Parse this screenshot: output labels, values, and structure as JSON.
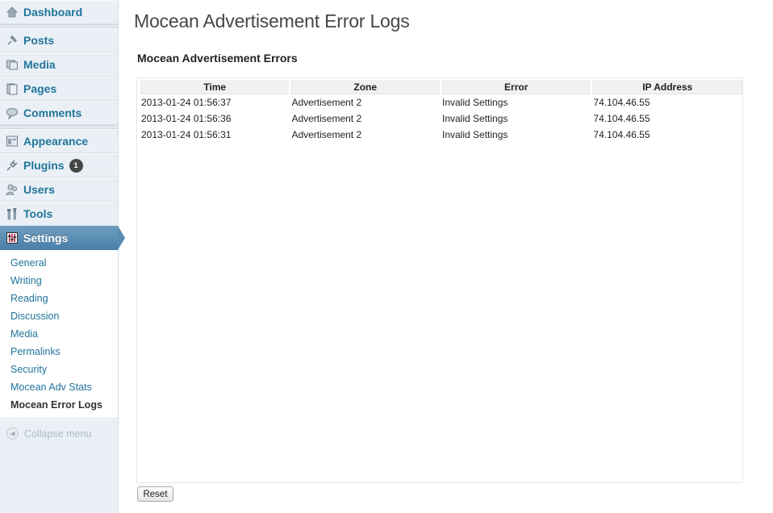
{
  "sidebar": {
    "items": [
      {
        "label": "Dashboard",
        "icon": "dashboard-icon"
      },
      {
        "label": "Posts",
        "icon": "pushpin-icon"
      },
      {
        "label": "Media",
        "icon": "media-icon"
      },
      {
        "label": "Pages",
        "icon": "pages-icon"
      },
      {
        "label": "Comments",
        "icon": "comment-icon"
      },
      {
        "label": "Appearance",
        "icon": "appearance-icon"
      },
      {
        "label": "Plugins",
        "icon": "plug-icon",
        "badge": "1"
      },
      {
        "label": "Users",
        "icon": "users-icon"
      },
      {
        "label": "Tools",
        "icon": "tools-icon"
      },
      {
        "label": "Settings",
        "icon": "settings-icon"
      }
    ],
    "submenu": [
      "General",
      "Writing",
      "Reading",
      "Discussion",
      "Media",
      "Permalinks",
      "Security",
      "Mocean Adv Stats",
      "Mocean Error Logs"
    ],
    "collapse_label": "Collapse menu"
  },
  "main": {
    "title": "Mocean Advertisement Error Logs",
    "section_title": "Mocean Advertisement Errors",
    "table": {
      "headers": [
        "Time",
        "Zone",
        "Error",
        "IP Address"
      ],
      "rows": [
        [
          "2013-01-24 01:56:37",
          "Advertisement 2",
          "Invalid Settings",
          "74.104.46.55"
        ],
        [
          "2013-01-24 01:56:36",
          "Advertisement 2",
          "Invalid Settings",
          "74.104.46.55"
        ],
        [
          "2013-01-24 01:56:31",
          "Advertisement 2",
          "Invalid Settings",
          "74.104.46.55"
        ]
      ]
    },
    "reset_label": "Reset"
  },
  "colors": {
    "link": "#21759b",
    "current_menu": "#5a8cb3",
    "sidebar_bg": "#eaf0f5"
  }
}
